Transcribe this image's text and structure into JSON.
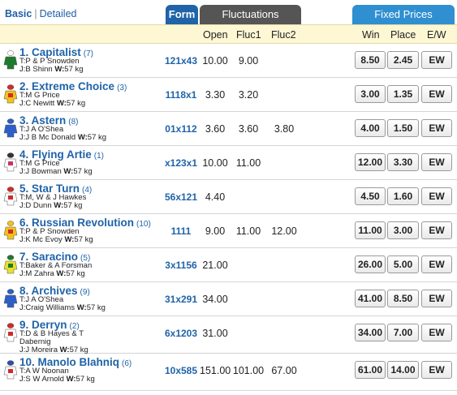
{
  "view_toggle": {
    "basic": "Basic",
    "separator": "|",
    "detailed": "Detailed"
  },
  "tabs": {
    "form": "Form",
    "fluctuations": "Fluctuations",
    "fixed_prices": "Fixed Prices"
  },
  "columns": {
    "open": "Open",
    "fluc1": "Fluc1",
    "fluc2": "Fluc2",
    "win": "Win",
    "place": "Place",
    "ew": "E/W"
  },
  "labels": {
    "trainer": "T:",
    "jockey": "J:",
    "weight": "W:"
  },
  "runners": [
    {
      "name": "1. Capitalist",
      "barrier": "(7)",
      "trainer": "P & P Snowden",
      "jockey": "B Shinn",
      "weight": "57 kg",
      "form": "121x43",
      "open": "10.00",
      "fluc1": "9.00",
      "fluc2": "",
      "win": "8.50",
      "place": "2.45",
      "ew": "EW",
      "silk_colors": [
        "#1e7a2e",
        "#1e7a2e",
        "#ffffff"
      ]
    },
    {
      "name": "2. Extreme Choice",
      "barrier": "(3)",
      "trainer": "M G Price",
      "jockey": "C Newitt",
      "weight": "57 kg",
      "form": "1118x1",
      "open": "3.30",
      "fluc1": "3.20",
      "fluc2": "",
      "win": "3.00",
      "place": "1.35",
      "ew": "EW",
      "silk_colors": [
        "#f2c21b",
        "#d22a2a",
        "#d22a2a"
      ]
    },
    {
      "name": "3. Astern",
      "barrier": "(8)",
      "trainer": "J A O'Shea",
      "jockey": "J B Mc Donald",
      "weight": "57 kg",
      "form": "01x112",
      "open": "3.60",
      "fluc1": "3.60",
      "fluc2": "3.80",
      "win": "4.00",
      "place": "1.50",
      "ew": "EW",
      "silk_colors": [
        "#2e5fc7",
        "#2e5fc7",
        "#2e5fc7"
      ]
    },
    {
      "name": "4. Flying Artie",
      "barrier": "(1)",
      "trainer": "M G Price",
      "jockey": "J Bowman",
      "weight": "57 kg",
      "form": "x123x1",
      "open": "10.00",
      "fluc1": "11.00",
      "fluc2": "",
      "win": "12.00",
      "place": "3.30",
      "ew": "EW",
      "silk_colors": [
        "#ffffff",
        "#c8326a",
        "#333333"
      ]
    },
    {
      "name": "5. Star Turn",
      "barrier": "(4)",
      "trainer": "M, W & J Hawkes",
      "jockey": "D Dunn",
      "weight": "57 kg",
      "form": "56x121",
      "open": "4.40",
      "fluc1": "",
      "fluc2": "",
      "win": "4.50",
      "place": "1.60",
      "ew": "EW",
      "silk_colors": [
        "#ffffff",
        "#d22a2a",
        "#d22a2a"
      ]
    },
    {
      "name": "6. Russian Revolution",
      "barrier": "(10)",
      "trainer": "P & P Snowden",
      "jockey": "K Mc Evoy",
      "weight": "57 kg",
      "form": "1111",
      "open": "9.00",
      "fluc1": "11.00",
      "fluc2": "12.00",
      "win": "11.00",
      "place": "3.00",
      "ew": "EW",
      "silk_colors": [
        "#f2c21b",
        "#d22a2a",
        "#f2c21b"
      ]
    },
    {
      "name": "7. Saracino",
      "barrier": "(5)",
      "trainer": "Baker & A Forsman",
      "jockey": "M Zahra",
      "weight": "57 kg",
      "form": "3x1156",
      "open": "21.00",
      "fluc1": "",
      "fluc2": "",
      "win": "26.00",
      "place": "5.00",
      "ew": "EW",
      "silk_colors": [
        "#e8e02a",
        "#1e7a2e",
        "#1e7a2e"
      ]
    },
    {
      "name": "8. Archives",
      "barrier": "(9)",
      "trainer": "J A O'Shea",
      "jockey": "Craig Williams",
      "weight": "57 kg",
      "form": "31x291",
      "open": "34.00",
      "fluc1": "",
      "fluc2": "",
      "win": "41.00",
      "place": "8.50",
      "ew": "EW",
      "silk_colors": [
        "#2e5fc7",
        "#2e5fc7",
        "#2e5fc7"
      ]
    },
    {
      "name": "9. Derryn",
      "barrier": "(2)",
      "trainer": "D & B Hayes & T",
      "trainer_line2": "Dabernig",
      "jockey": "J Moreira",
      "weight": "57 kg",
      "form": "6x1203",
      "open": "31.00",
      "fluc1": "",
      "fluc2": "",
      "win": "34.00",
      "place": "7.00",
      "ew": "EW",
      "silk_colors": [
        "#ffffff",
        "#d22a2a",
        "#d22a2a"
      ]
    },
    {
      "name": "10. Manolo Blahniq",
      "barrier": "(6)",
      "trainer": "A W Noonan",
      "jockey": "S W Arnold",
      "weight": "57 kg",
      "form": "10x585",
      "open": "151.00",
      "fluc1": "101.00",
      "fluc2": "67.00",
      "win": "61.00",
      "place": "14.00",
      "ew": "EW",
      "silk_colors": [
        "#ffffff",
        "#d22a2a",
        "#2e4fa8"
      ]
    }
  ]
}
